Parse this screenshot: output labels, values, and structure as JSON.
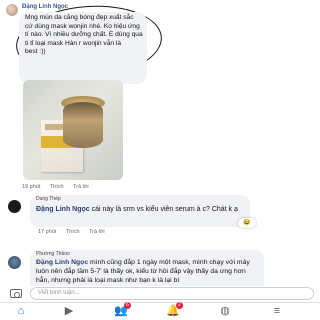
{
  "comment1": {
    "author": "Đặng Linh Ngọc",
    "text": "Mng mún da căng bóng đẹp xuất sắc\ncứ dùng mask wonjin nhé. Ko hiệu ứng\ntí nào. Vì nhiều dưỡng chất. E dùng qua\nti tỉ loại mask Hàn r wonjin vẫn là\nbest :))",
    "time": "19 phút",
    "like": "Thích",
    "reply": "Trả lời"
  },
  "comment2": {
    "author": "Dung Thép",
    "mention": "Đặng Linh Ngọc",
    "text": " cái này là srm vs kiểu viên serum à c? Chát k ạ",
    "time": "17 phút",
    "like": "Thích",
    "reply": "Trả lời",
    "reaction": "😂"
  },
  "comment3": {
    "author": "Phương Thảoo",
    "mention": "Đặng Linh Ngọc",
    "text": " mình cũng đắp 1 ngày một mask, mình chạy với máy luôn nên đắp tầm 5-7' là thấy ok, kiểu từ hồi đắp vậy thấy da ưng hơn hẳn, nhưng phải là loại mask như bạn k là lại bí"
  },
  "composer": {
    "placeholder": "Viết bình luận..."
  },
  "tabbar": {
    "badge_people": "6",
    "badge_bell": "2"
  }
}
